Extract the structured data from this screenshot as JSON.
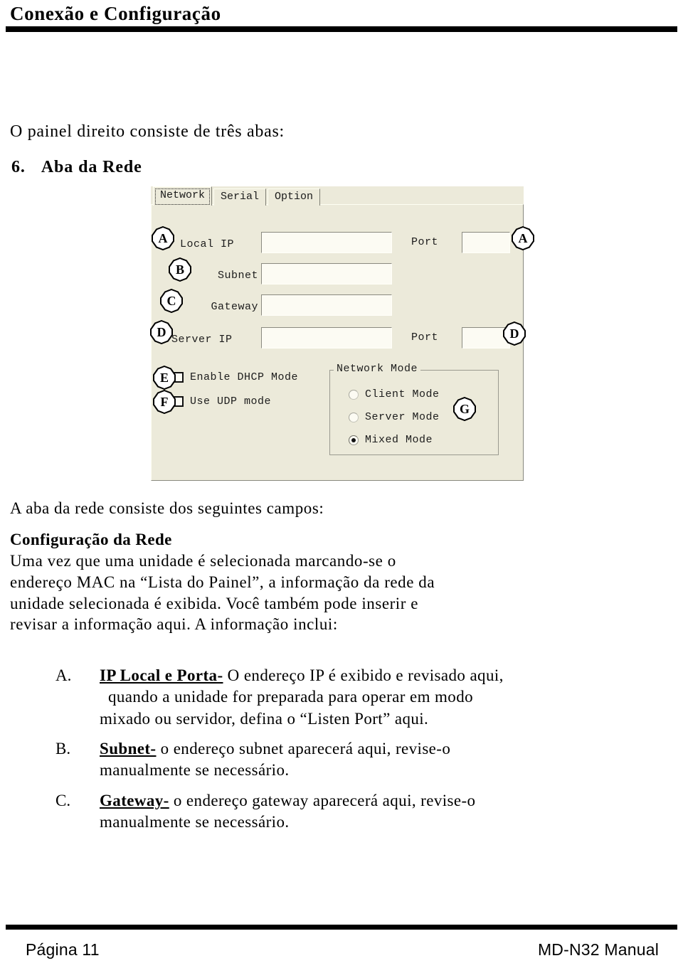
{
  "header": {
    "title": "Conexão e Configuração"
  },
  "intro": {
    "line": "O painel direito consiste de três abas:"
  },
  "section": {
    "number": "6.",
    "title": "Aba da Rede"
  },
  "dialog": {
    "tabs": [
      {
        "label": "Network",
        "active": true
      },
      {
        "label": "Serial",
        "active": false
      },
      {
        "label": "Option",
        "active": false
      }
    ],
    "fields": [
      {
        "label": "Local IP",
        "value": "",
        "callout": "A"
      },
      {
        "label": "Subnet",
        "value": "",
        "callout": "B"
      },
      {
        "label": "Gateway",
        "value": "",
        "callout": "C"
      },
      {
        "label": "Server IP",
        "value": "",
        "callout": "D"
      }
    ],
    "port_label_top": "Port",
    "port_value_top": "",
    "port_callout_top": "A",
    "port_label_bottom": "Port",
    "port_value_bottom": "",
    "port_callout_bottom": "D",
    "checkboxes": [
      {
        "label": "Enable DHCP Mode",
        "checked": false,
        "callout": "E"
      },
      {
        "label": "Use UDP mode",
        "checked": false,
        "callout": "F"
      }
    ],
    "network_mode": {
      "legend": "Network Mode",
      "callout": "G",
      "options": [
        {
          "label": "Client Mode",
          "selected": false,
          "dim": true
        },
        {
          "label": "Server Mode",
          "selected": false,
          "dim": true
        },
        {
          "label": "Mixed Mode",
          "selected": true,
          "dim": false
        }
      ]
    }
  },
  "body": {
    "lead_line": "A aba da rede consiste dos seguintes campos:",
    "subheading": "Configuração da Rede",
    "paragraph_lines": [
      "Uma vez que uma unidade é selecionada marcando-se o",
      "endereço MAC na “Lista do Painel”, a informação da rede da",
      "unidade selecionada é exibida. Você também pode inserir e",
      "revisar a informação aqui. A informação inclui:"
    ]
  },
  "items": [
    {
      "marker": "A.",
      "lead": "IP Local e Porta-",
      "lines": [
        {
          "text": " O endereço IP é exibido e revisado aqui,",
          "indent": false,
          "with_lead": true
        },
        {
          "text": "quando a unidade for preparada para operar em modo",
          "indent": true,
          "with_lead": false
        },
        {
          "text": "mixado ou servidor, defina o “Listen Port” aqui.",
          "indent": false,
          "with_lead": false
        }
      ]
    },
    {
      "marker": "B.",
      "lead": "Subnet-",
      "lines": [
        {
          "text": " o endereço subnet aparecerá aqui, revise-o",
          "indent": false,
          "with_lead": true
        },
        {
          "text": "manualmente se necessário.",
          "indent": false,
          "with_lead": false
        }
      ]
    },
    {
      "marker": "C.",
      "lead": "Gateway-",
      "lines": [
        {
          "text": " o endereço gateway aparecerá aqui, revise-o",
          "indent": false,
          "with_lead": true
        },
        {
          "text": "manualmente se necessário.",
          "indent": false,
          "with_lead": false
        }
      ]
    }
  ],
  "footer": {
    "left": "Página 11",
    "right": "MD-N32 Manual"
  },
  "colors": {
    "dialog_face": "#ECEADA",
    "field_face": "#FCFBF3",
    "rule": "#000000",
    "border_shadow": "#88887e"
  }
}
